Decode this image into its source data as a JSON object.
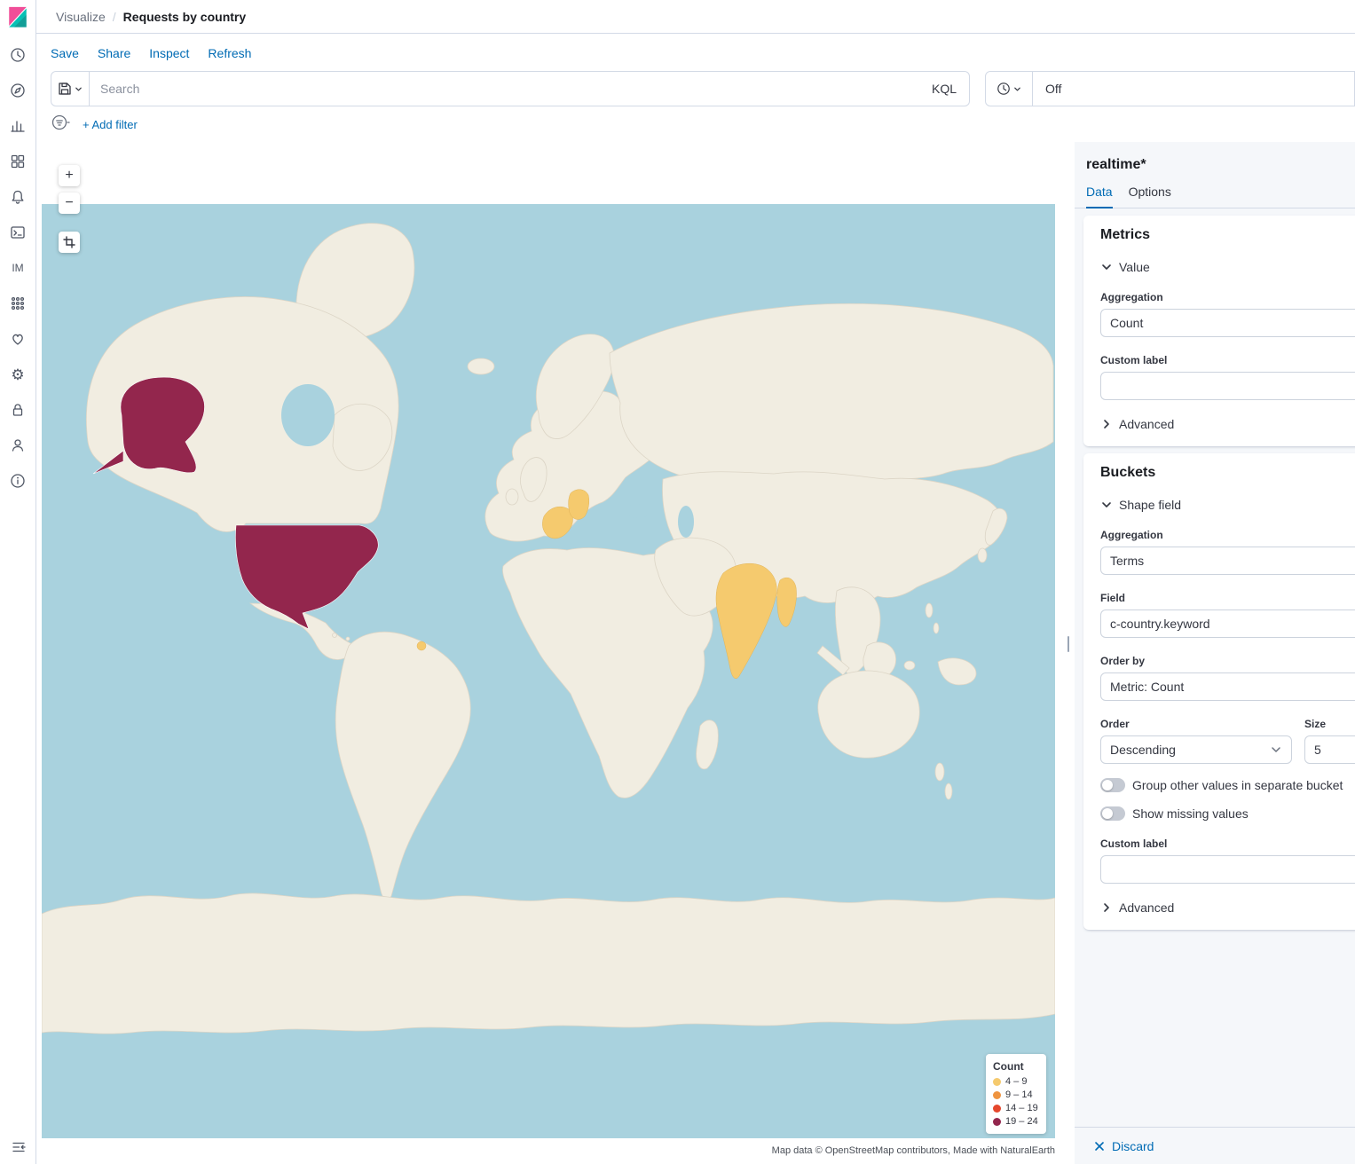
{
  "header": {
    "breadcrumb_parent": "Visualize",
    "separator": "/",
    "breadcrumb_current": "Requests by country"
  },
  "actions": {
    "save": "Save",
    "share": "Share",
    "inspect": "Inspect",
    "refresh": "Refresh"
  },
  "query": {
    "placeholder": "Search",
    "language": "KQL",
    "refresh_state": "Off"
  },
  "filters": {
    "add_filter": "+ Add filter"
  },
  "sidebar": {
    "im": "IM"
  },
  "map": {
    "zoom_in": "+",
    "zoom_out": "−",
    "colors": {
      "water": "#a9d2de",
      "land": "#f1ede1",
      "country_high": "#93264d",
      "country_low": "#f5ca6e"
    },
    "legend": {
      "title": "Count",
      "items": [
        {
          "label": "4 – 9",
          "color": "#f5ca6e"
        },
        {
          "label": "9 – 14",
          "color": "#ef9440"
        },
        {
          "label": "14 – 19",
          "color": "#e5472d"
        },
        {
          "label": "19 – 24",
          "color": "#93264d"
        }
      ]
    },
    "countries": [
      {
        "name": "United States",
        "bucket": "19 – 24"
      },
      {
        "name": "France",
        "bucket": "4 – 9"
      },
      {
        "name": "Germany",
        "bucket": "4 – 9"
      },
      {
        "name": "India",
        "bucket": "4 – 9"
      },
      {
        "name": "Myanmar",
        "bucket": "4 – 9"
      },
      {
        "name": "Suriname",
        "bucket": "4 – 9"
      }
    ],
    "attribution": "Map data © OpenStreetMap contributors, Made with NaturalEarth"
  },
  "panel": {
    "index_pattern": "realtime*",
    "tabs": {
      "data": "Data",
      "options": "Options"
    },
    "metrics": {
      "title": "Metrics",
      "agg_toggle": "Value",
      "aggregation_label": "Aggregation",
      "aggregation_value": "Count",
      "custom_label": "Custom label",
      "advanced": "Advanced"
    },
    "buckets": {
      "title": "Buckets",
      "agg_toggle": "Shape field",
      "aggregation_label": "Aggregation",
      "aggregation_value": "Terms",
      "field_label": "Field",
      "field_value": "c-country.keyword",
      "order_by_label": "Order by",
      "order_by_value": "Metric: Count",
      "order_label": "Order",
      "order_value": "Descending",
      "size_label": "Size",
      "size_value": "5",
      "group_other": "Group other values in separate bucket",
      "show_missing": "Show missing values",
      "custom_label": "Custom label",
      "advanced": "Advanced"
    },
    "discard": "Discard"
  }
}
